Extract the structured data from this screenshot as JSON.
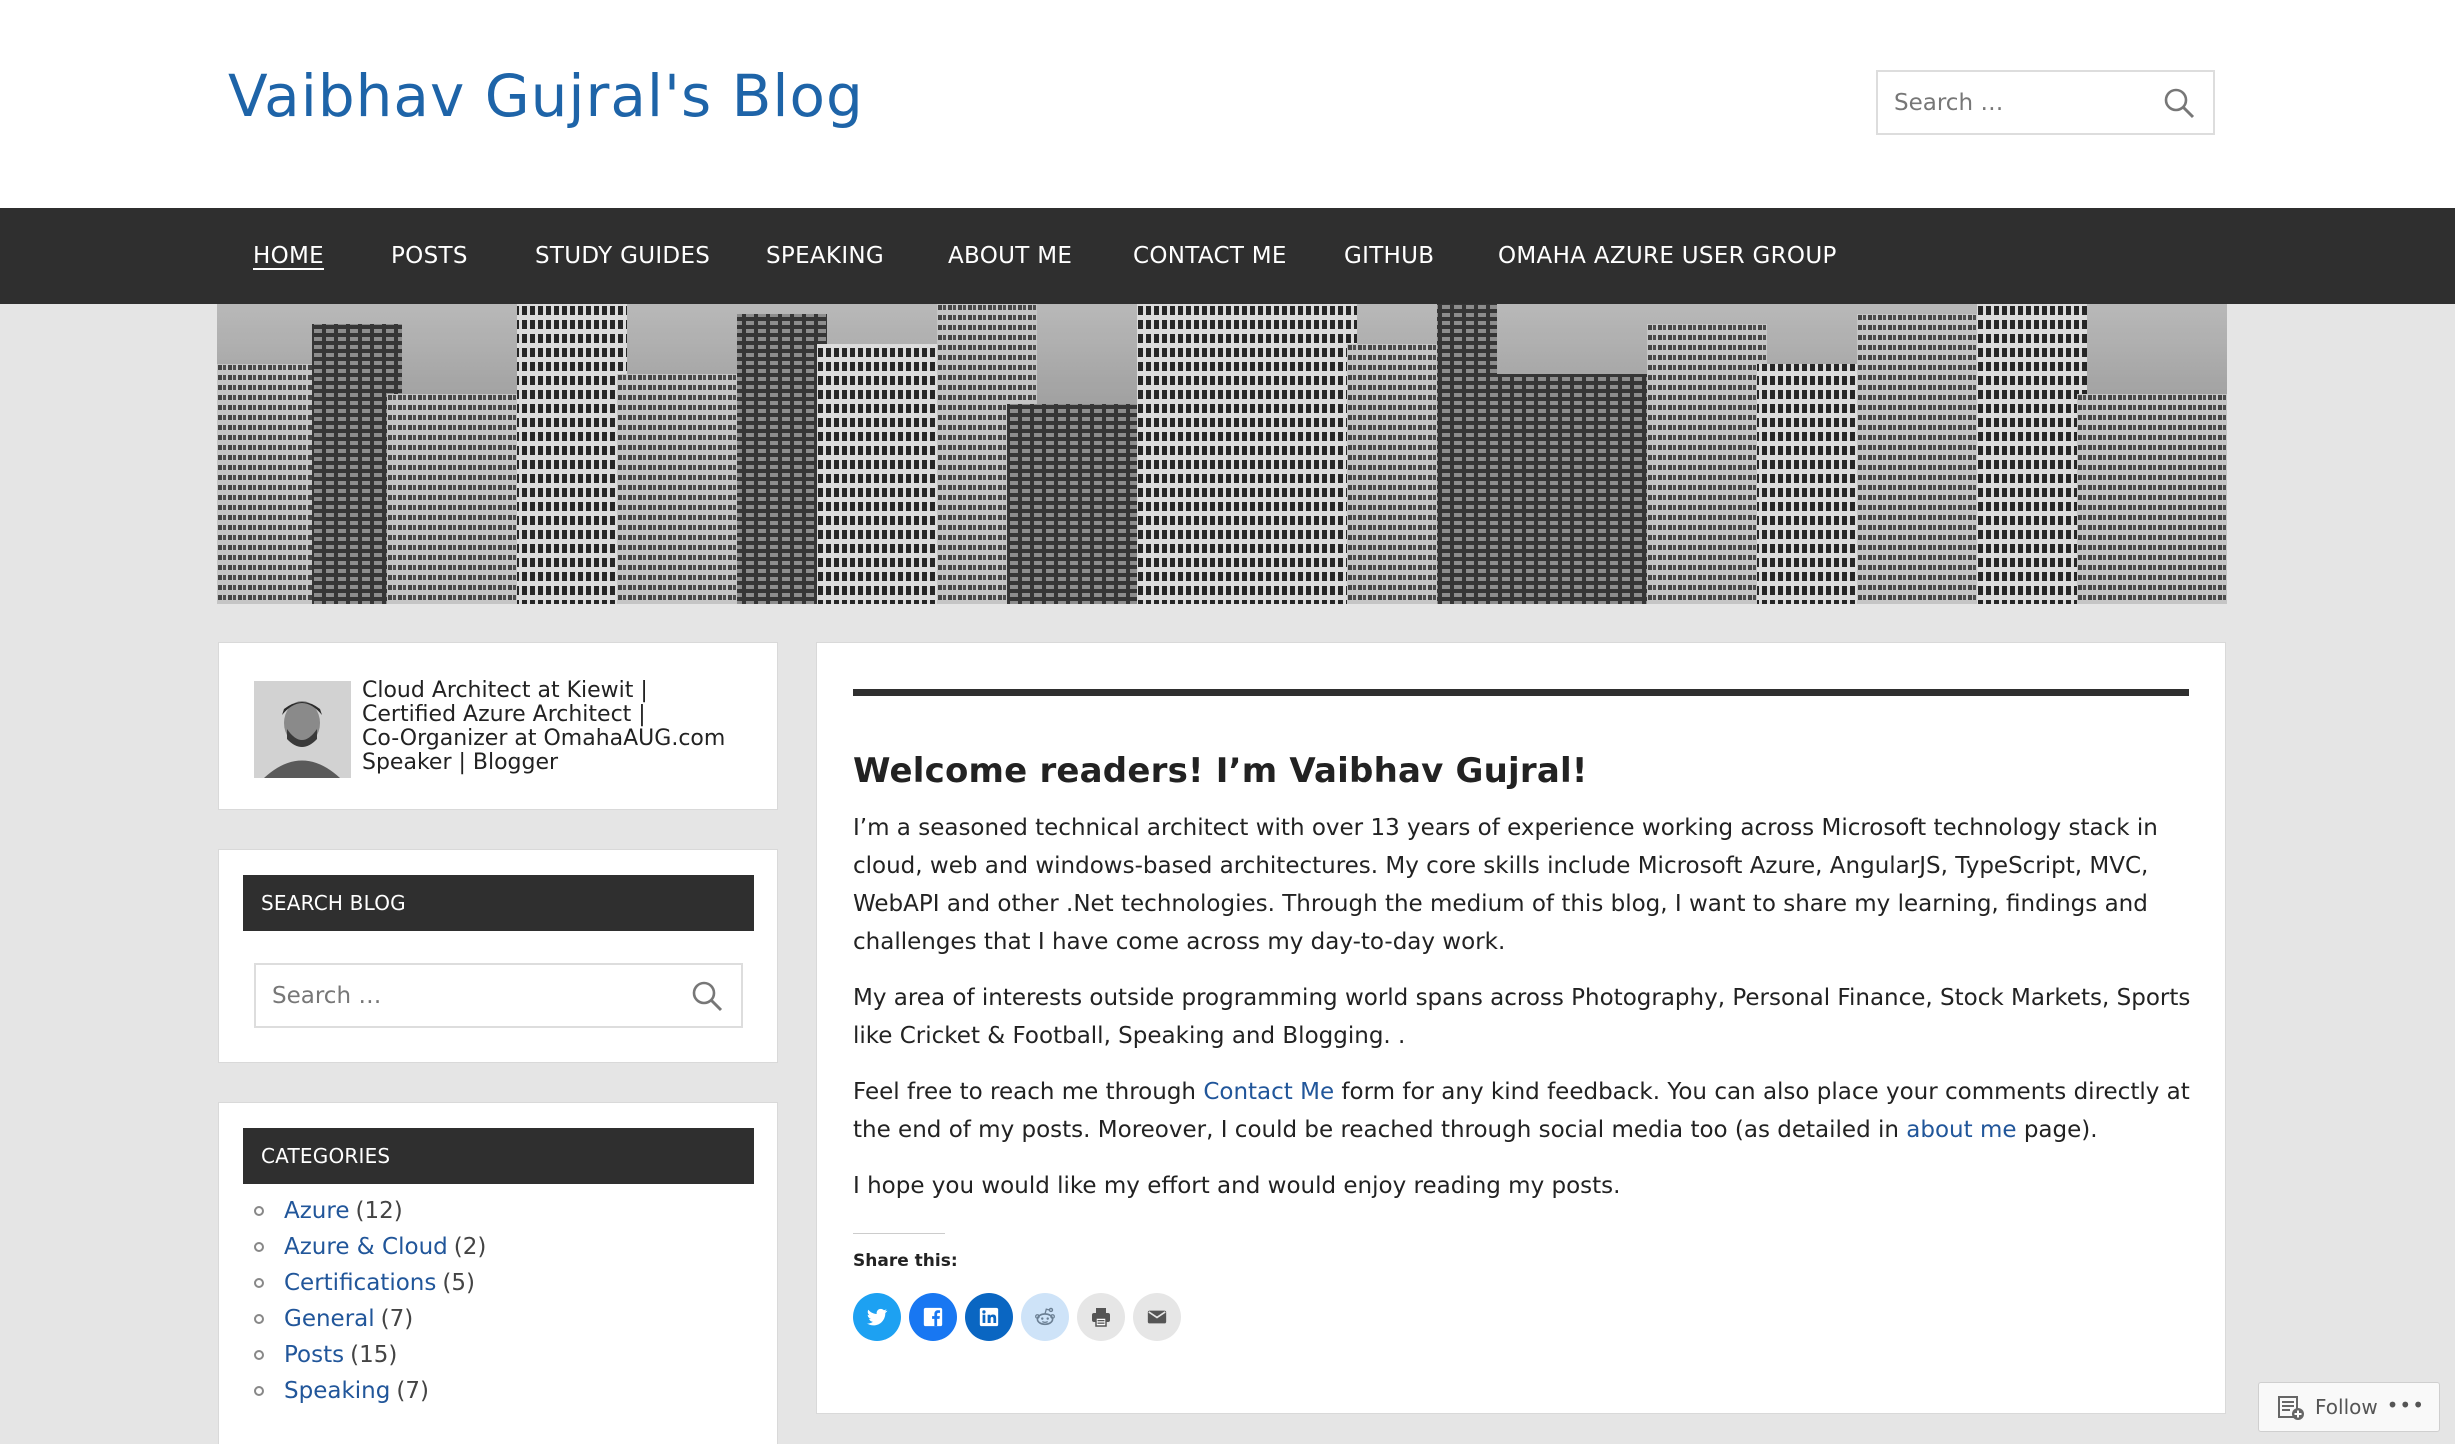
{
  "header": {
    "site_title": "Vaibhav Gujral's Blog",
    "search_placeholder": "Search …"
  },
  "nav": {
    "items": [
      {
        "label": "HOME",
        "active": true
      },
      {
        "label": "POSTS"
      },
      {
        "label": "STUDY GUIDES"
      },
      {
        "label": "SPEAKING"
      },
      {
        "label": "ABOUT ME"
      },
      {
        "label": "CONTACT ME"
      },
      {
        "label": "GITHUB"
      },
      {
        "label": "OMAHA AZURE USER GROUP"
      }
    ]
  },
  "sidebar": {
    "profile": {
      "line1": "Cloud Architect at Kiewit |",
      "line2": "Certified Azure Architect |",
      "line3": "Co-Organizer at OmahaAUG.com",
      "line4": "Speaker | Blogger"
    },
    "search_widget": {
      "title": "SEARCH BLOG",
      "placeholder": "Search …"
    },
    "categories_widget": {
      "title": "CATEGORIES",
      "items": [
        {
          "name": "Azure",
          "count": "(12)"
        },
        {
          "name": "Azure & Cloud",
          "count": "(2)"
        },
        {
          "name": "Certifications",
          "count": "(5)"
        },
        {
          "name": "General",
          "count": "(7)"
        },
        {
          "name": "Posts",
          "count": "(15)"
        },
        {
          "name": "Speaking",
          "count": "(7)"
        }
      ]
    }
  },
  "post": {
    "title": "Welcome readers! I’m Vaibhav Gujral!",
    "para1": "I’m a seasoned technical architect with over 13 years of experience working across Microsoft technology stack in cloud, web and windows-based architectures. My core skills include Microsoft Azure, AngularJS, TypeScript, MVC, WebAPI and other .Net technologies. Through the medium of this blog, I want to share my learning, findings and challenges that I have come across my day-to-day work.",
    "para2": "My area of interests outside programming world spans across Photography, Personal Finance, Stock Markets, Sports like Cricket & Football, Speaking and Blogging. .",
    "para3_pre": "Feel free to reach me through ",
    "para3_link1": "Contact Me",
    "para3_mid": " form for any kind feedback. You can also place your comments directly at the end of my posts. Moreover, I could be reached through social media too (as detailed in ",
    "para3_link2": "about me",
    "para3_post": " page).",
    "para4": "I hope you would like my effort and would enjoy reading my posts.",
    "share_label": "Share this:"
  },
  "colors": {
    "title_blue": "#1e64a8",
    "link_blue": "#21569a",
    "nav_bg": "#2f2f2f",
    "page_bg": "#e5e5e5",
    "twitter": "#1da1f2",
    "facebook": "#1877f2",
    "linkedin": "#0a66c2",
    "reddit_bg": "#cee3f8"
  },
  "follow": {
    "label": "Follow",
    "more": "•••"
  }
}
